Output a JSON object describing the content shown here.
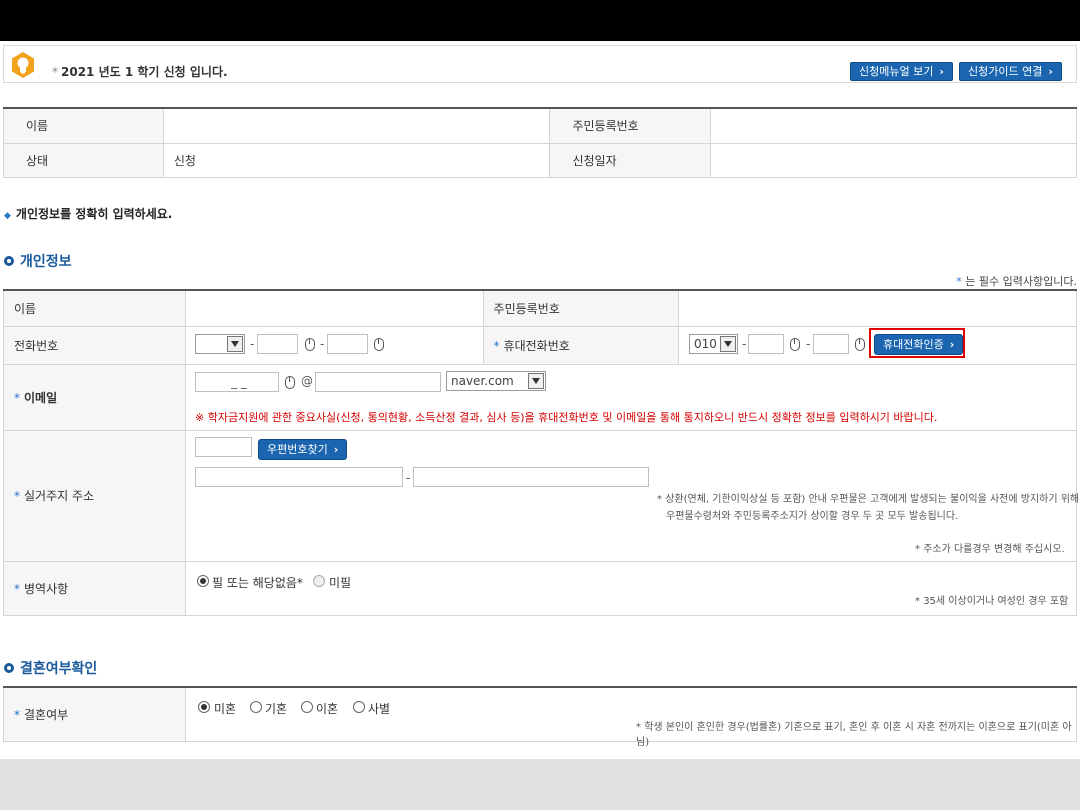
{
  "notice": {
    "star": "*",
    "text": "2021 년도 1 학기 신청 입니다.",
    "manual_button": "신청메뉴얼 보기",
    "guide_button": "신청가이드 연결",
    "chevron": "›"
  },
  "summary": {
    "name_label": "이름",
    "name_value": "",
    "rrn_label": "주민등록번호",
    "rrn_value": "",
    "status_label": "상태",
    "status_value": "신청",
    "date_label": "신청일자",
    "date_value": ""
  },
  "instruction": "개인정보를 정확히 입력하세요.",
  "personal": {
    "title": "개인정보",
    "required_note": "는 필수 입력사항입니다.",
    "required_star": "*",
    "name_label": "이름",
    "rrn_label": "주민등록번호",
    "phone_label": "전화번호",
    "mobile_label": "휴대전화번호",
    "mobile_prefix": "010",
    "mobile_verify_button": "휴대전화인증",
    "email_label": "이메일",
    "email_local_placeholder": "_ _",
    "at": "@",
    "email_domain": "naver.com",
    "email_warning": "※ 학자금지원에 관한 중요사실(신청, 통의현황, 소득산정 결과, 심사 등)을 휴대전화번호 및 이메일을 통해 통지하오니 반드시 정확한 정보를 입력하시기 바랍니다.",
    "address_label": "실거주지 주소",
    "zip_button": "우편번호찾기",
    "address_note_1": "상환(연체, 기한이익상실 등 포함) 안내 우편물은 고객에게 발생되는 불이익을 사전에 방지하기 위해",
    "address_note_2": "우편물수령처와 주민등록주소지가 상이할 경우 두 곳 모두 발송됩니다.",
    "address_note_3": "주소가 다를경우 변경해 주십시오.",
    "military_label": "병역사항",
    "military_opt1": "필 또는 해당없음*",
    "military_opt2": "미필",
    "military_note": "35세 이상이거나 여성인 경우 포함"
  },
  "marriage": {
    "title": "결혼여부확인",
    "label": "결혼여부",
    "options": [
      "미혼",
      "기혼",
      "이혼",
      "사별"
    ],
    "note": "학생 본인이 혼인한 경우(법률혼) 기혼으로 표기, 혼인 후 이혼 시 자혼 전까지는 이혼으로 표기(미혼 아님)"
  },
  "colors": {
    "accent": "#1a64b0",
    "title": "#1a5a9c",
    "warning": "#d40000",
    "highlight": "#e00000"
  }
}
